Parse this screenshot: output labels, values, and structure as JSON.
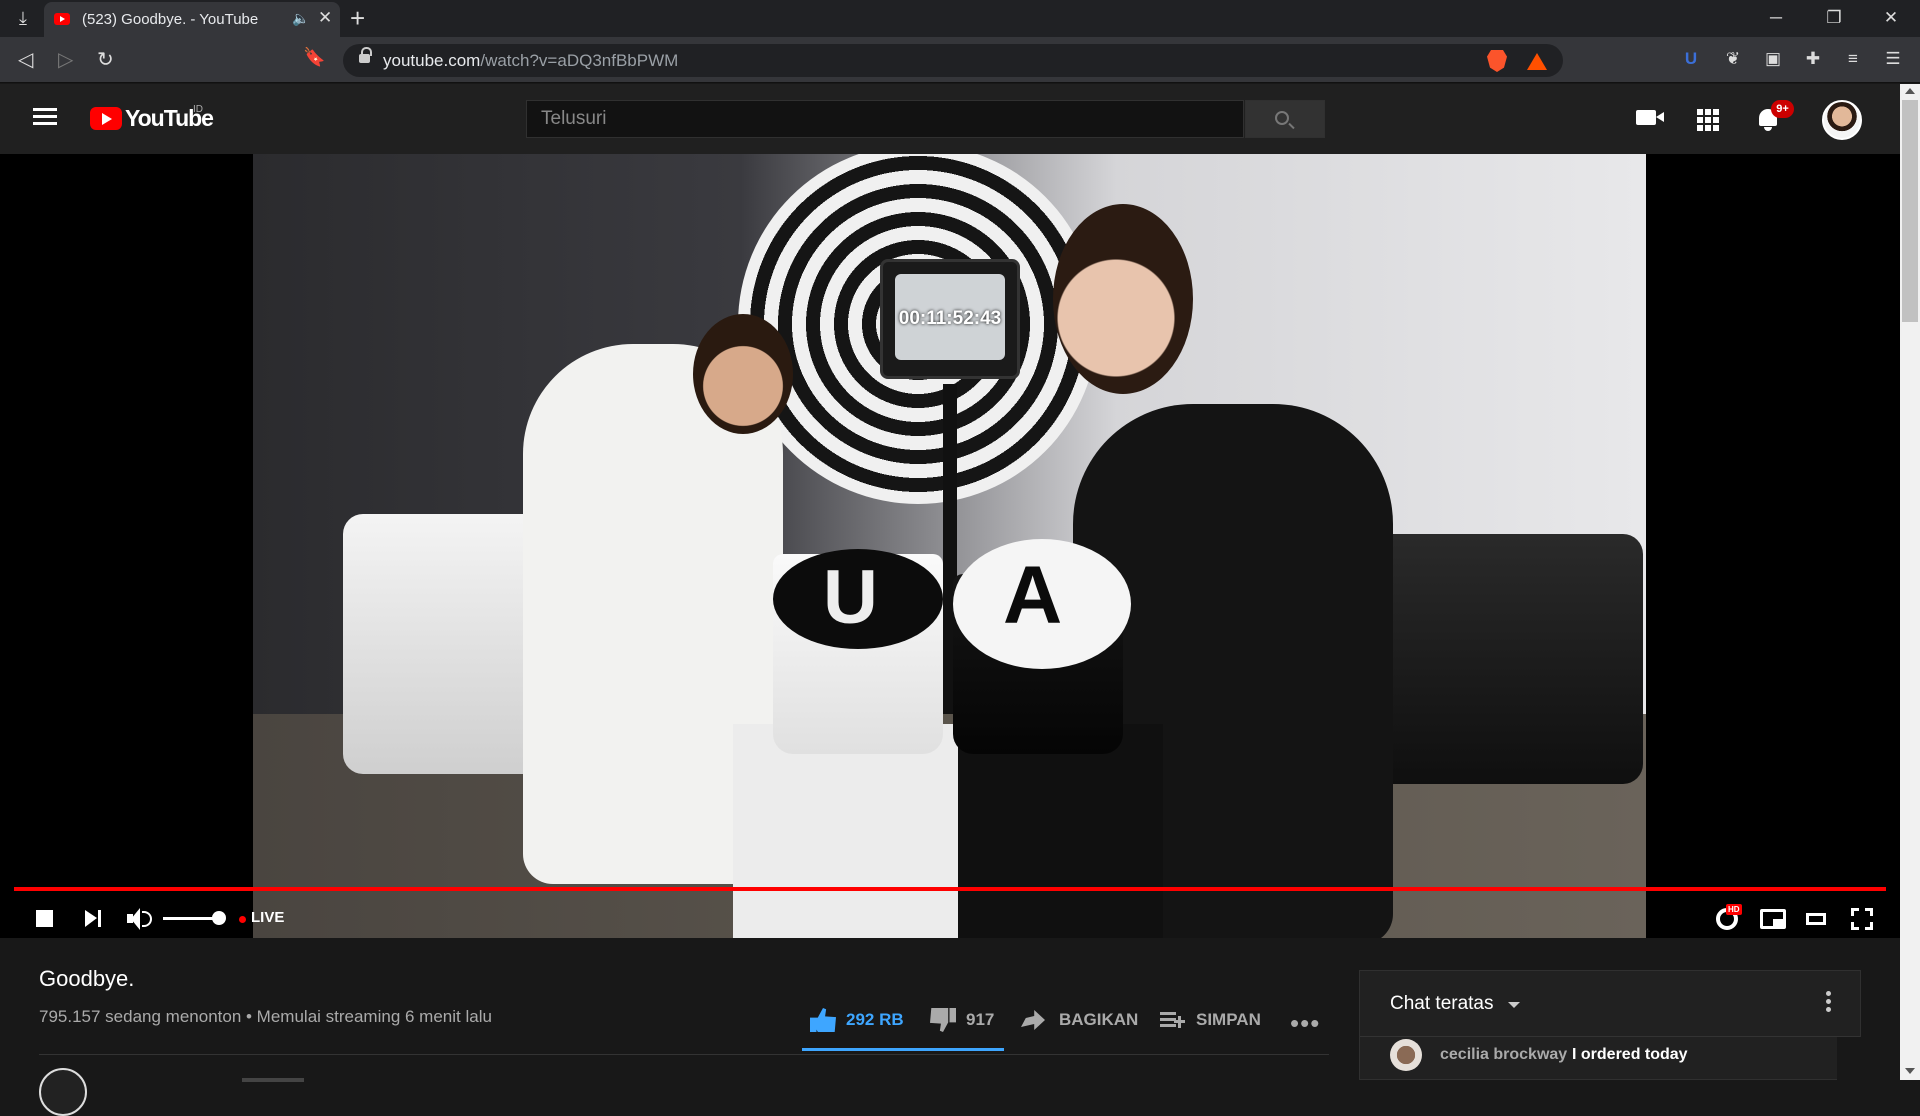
{
  "browser": {
    "tab_title": "(523) Goodbye. - YouTube",
    "url_host": "youtube.com",
    "url_path": "/watch?v=aDQ3nfBbPWM"
  },
  "youtube": {
    "logo_text": "YouTube",
    "region": "ID",
    "search_placeholder": "Telusuri",
    "notification_count": "9+"
  },
  "player": {
    "tv_time": "00:11:52:43",
    "live_label": "LIVE",
    "box_left_letter": "U",
    "box_right_letter": "A",
    "hd_badge": "HD",
    "volume_level": 1.0,
    "progress": 1.0
  },
  "video": {
    "title": "Goodbye.",
    "meta": "795.157 sedang menonton • Memulai streaming 6 menit lalu",
    "likes": "292 RB",
    "dislikes": "917",
    "share_label": "BAGIKAN",
    "save_label": "SIMPAN",
    "more_label": "•••"
  },
  "chat": {
    "title": "Chat teratas",
    "messages": [
      {
        "user": "cecilia brockway",
        "text": "I ordered today"
      }
    ]
  },
  "colors": {
    "accent_red": "#ff0000",
    "like_blue": "#3ea6ff",
    "bg_dark": "#181818"
  }
}
